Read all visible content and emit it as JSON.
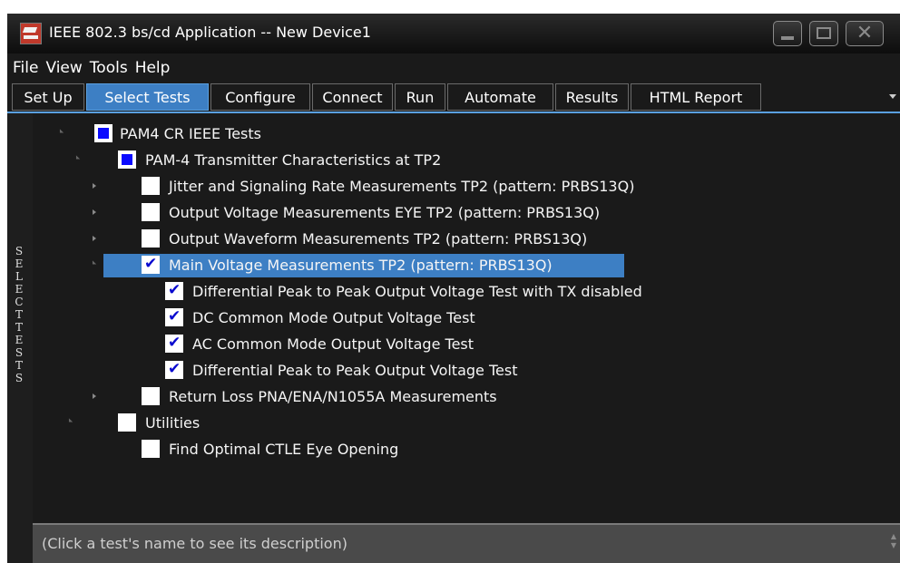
{
  "window": {
    "title": "IEEE 802.3 bs/cd Application -- New Device1"
  },
  "menu": [
    "File",
    "View",
    "Tools",
    "Help"
  ],
  "tabs": [
    {
      "label": "Set Up",
      "active": false
    },
    {
      "label": "Select Tests",
      "active": true
    },
    {
      "label": "Configure",
      "active": false
    },
    {
      "label": "Connect",
      "active": false
    },
    {
      "label": "Run",
      "active": false
    },
    {
      "label": "Automate",
      "active": false
    },
    {
      "label": "Results",
      "active": false
    },
    {
      "label": "HTML Report",
      "active": false
    }
  ],
  "side_label": "SELECT TESTS",
  "tree": [
    {
      "label": "PAM4 CR IEEE Tests",
      "state": "partial",
      "expanded": true
    },
    {
      "label": "PAM-4 Transmitter Characteristics at TP2",
      "state": "partial",
      "expanded": true
    },
    {
      "label": "Jitter and Signaling Rate Measurements TP2 (pattern: PRBS13Q)",
      "state": "unchecked",
      "expanded": false
    },
    {
      "label": "Output Voltage Measurements EYE TP2 (pattern: PRBS13Q)",
      "state": "unchecked",
      "expanded": false
    },
    {
      "label": "Output Waveform Measurements TP2 (pattern: PRBS13Q)",
      "state": "unchecked",
      "expanded": false
    },
    {
      "label": "Main Voltage Measurements TP2 (pattern: PRBS13Q)",
      "state": "checked",
      "expanded": true,
      "selected": true
    },
    {
      "label": "Differential Peak to Peak Output Voltage Test with TX disabled",
      "state": "checked"
    },
    {
      "label": "DC Common Mode Output Voltage Test",
      "state": "checked"
    },
    {
      "label": "AC Common Mode Output Voltage Test",
      "state": "checked"
    },
    {
      "label": "Differential Peak to Peak Output Voltage Test",
      "state": "checked"
    },
    {
      "label": "Return Loss PNA/ENA/N1055A Measurements",
      "state": "unchecked",
      "expanded": false
    },
    {
      "label": "Utilities",
      "state": "unchecked",
      "expanded": true
    },
    {
      "label": "Find Optimal CTLE Eye Opening",
      "state": "unchecked"
    }
  ],
  "description": "(Click a test's name to see its description)",
  "colors": {
    "selection": "#3d7fc4",
    "partial_fill": "#0a0aff",
    "background": "#1a1a1a"
  }
}
